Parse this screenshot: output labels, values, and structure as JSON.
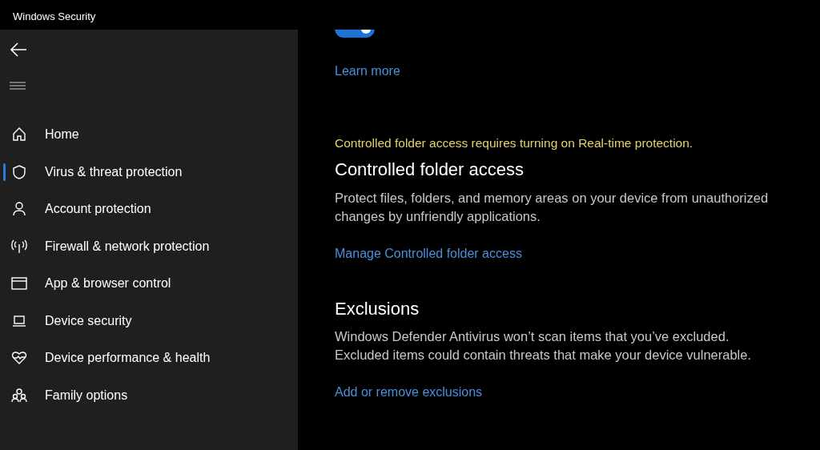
{
  "window": {
    "title": "Windows Security"
  },
  "sidebar": {
    "items": [
      {
        "label": "Home",
        "selected": false
      },
      {
        "label": "Virus & threat protection",
        "selected": true
      },
      {
        "label": "Account protection",
        "selected": false
      },
      {
        "label": "Firewall & network protection",
        "selected": false
      },
      {
        "label": "App & browser control",
        "selected": false
      },
      {
        "label": "Device security",
        "selected": false
      },
      {
        "label": "Device performance & health",
        "selected": false
      },
      {
        "label": "Family options",
        "selected": false
      }
    ]
  },
  "toggle": {
    "on": true
  },
  "learn_more": "Learn more",
  "warning": "Controlled folder access requires turning on Real-time protection.",
  "sections": [
    {
      "title": "Controlled folder access",
      "description_lines": [
        "Protect files, folders, and memory areas on your device from unauthorized",
        "changes by unfriendly applications."
      ],
      "link": "Manage Controlled folder access"
    },
    {
      "title": "Exclusions",
      "description_lines": [
        "Windows Defender Antivirus won’t scan items that you’ve excluded.",
        "Excluded items could contain threats that make your device vulnerable."
      ],
      "link": "Add or remove exclusions"
    }
  ]
}
